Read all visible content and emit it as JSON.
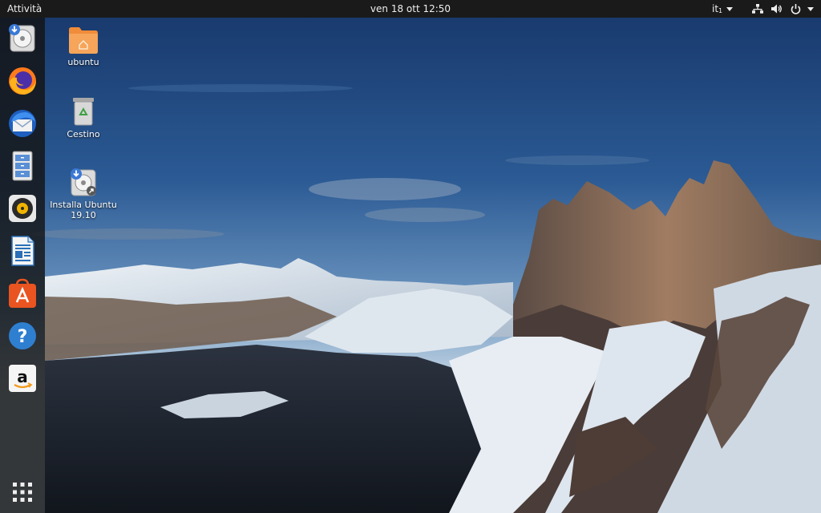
{
  "topbar": {
    "activities_label": "Attività",
    "clock": "ven 18 ott  12:50",
    "keyboard_layout": "it",
    "keyboard_layout_suffix": "1"
  },
  "tray_icons": [
    "network-icon",
    "volume-icon",
    "power-icon"
  ],
  "dock": {
    "items": [
      "installer-icon",
      "firefox-icon",
      "thunderbird-icon",
      "files-icon",
      "rhythmbox-icon",
      "libreoffice-writer-icon",
      "software-center-icon",
      "help-icon",
      "amazon-icon"
    ],
    "show_apps_icon": "app-grid-icon"
  },
  "desktop": {
    "icons": [
      {
        "label": "ubuntu",
        "icon": "home-folder-icon"
      },
      {
        "label": "Cestino",
        "icon": "trash-icon"
      },
      {
        "label": "Installa Ubuntu 19.10",
        "icon": "installer-shortcut-icon"
      }
    ]
  },
  "colors": {
    "topbar_bg": "#1a1a1a",
    "dock_bg": "#141414",
    "folder_orange": "#f08c3a",
    "ubuntu_orange": "#e95420",
    "help_blue": "#2f7fd0"
  }
}
